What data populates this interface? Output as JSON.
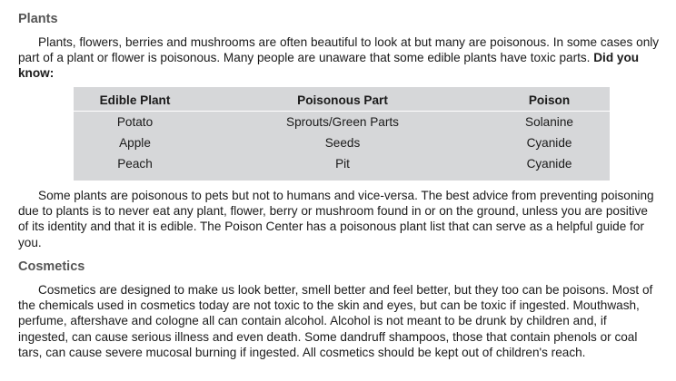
{
  "sections": {
    "plants": {
      "heading": "Plants",
      "intro_text": "Plants, flowers, berries  and mushrooms are often beautiful to look at but many are poisonous.  In some cases only part of a plant or flower is poisonous.  Many people are unaware that some edible plants have toxic parts. ",
      "did_you_know": "Did you know:",
      "table": {
        "headers": [
          "Edible Plant",
          "Poisonous Part",
          "Poison"
        ],
        "rows": [
          [
            "Potato",
            "Sprouts/Green Parts",
            "Solanine"
          ],
          [
            "Apple",
            "Seeds",
            "Cyanide"
          ],
          [
            "Peach",
            "Pit",
            "Cyanide"
          ]
        ]
      },
      "advice_text": "Some plants are poisonous to pets but not to humans and vice-versa. The best advice from preventing poisoning due to plants is to never eat any plant, flower, berry or mushroom found in or on the ground, unless you are positive of its identity and that it is edible. The Poison  Center has a poisonous plant list that can serve as a helpful guide for you."
    },
    "cosmetics": {
      "heading": "Cosmetics",
      "text": "Cosmetics are designed to make us look better, smell better and feel better, but they too can be poisons. Most of the chemicals used in cosmetics today are not toxic to the skin and eyes, but can be toxic if ingested. Mouthwash, perfume, aftershave and cologne all can contain alcohol. Alcohol is not meant to be drunk by children and, if ingested, can cause serious illness and even death. Some dandruff shampoos, those that contain phenols or coal tars, can cause severe mucosal burning if ingested. All cosmetics should be kept out of children's reach."
    }
  },
  "colors": {
    "heading": "#555555",
    "table_background": "#d6d7d9",
    "text": "#1a1a1a"
  }
}
